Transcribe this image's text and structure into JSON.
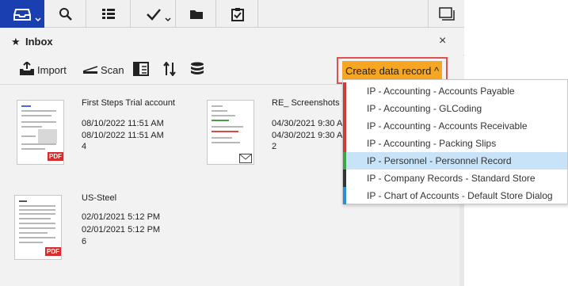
{
  "topbar": {
    "tabs": [
      {
        "icon": "inbox-icon",
        "active": true
      },
      {
        "icon": "search-icon"
      },
      {
        "icon": "list-icon"
      },
      {
        "icon": "check-icon"
      },
      {
        "icon": "folder-icon"
      },
      {
        "icon": "clipboard-icon"
      }
    ],
    "right_icon": "window-icon"
  },
  "header": {
    "title": "Inbox",
    "close": "×"
  },
  "toolbar": {
    "import_label": "Import",
    "scan_label": "Scan",
    "create_label": "Create data record ^"
  },
  "documents": [
    {
      "title": "First Steps Trial account",
      "date1": "08/10/2022 11:51 AM",
      "date2": "08/10/2022 11:51 AM",
      "count": "4",
      "type": "pdf"
    },
    {
      "title": "RE_ Screenshots f",
      "date1": "04/30/2021 9:30 A",
      "date2": "04/30/2021 9:30 A",
      "count": "2",
      "type": "email"
    },
    {
      "title": "US-Steel",
      "date1": "02/01/2021 5:12 PM",
      "date2": "02/01/2021 5:12 PM",
      "count": "6",
      "type": "pdf"
    }
  ],
  "dropdown": {
    "items": [
      {
        "label": "IP - Accounting - Accounts Payable",
        "color": "#d23a3a"
      },
      {
        "label": "IP - Accounting - GLCoding",
        "color": "#d23a3a"
      },
      {
        "label": "IP - Accounting - Accounts Receivable",
        "color": "#d23a3a"
      },
      {
        "label": "IP - Accounting - Packing Slips",
        "color": "#d23a3a"
      },
      {
        "label": "IP - Personnel - Personnel Record",
        "color": "#3aa546",
        "selected": true
      },
      {
        "label": "IP - Company Records - Standard Store",
        "color": "#333333"
      },
      {
        "label": "IP - Chart of Accounts - Default Store Dialog",
        "color": "#2a8fd8"
      }
    ]
  },
  "pdf_badge": "PDF",
  "accent_color": "#1a3fb0",
  "button_color": "#f5a623",
  "highlight_color": "#e0524b"
}
